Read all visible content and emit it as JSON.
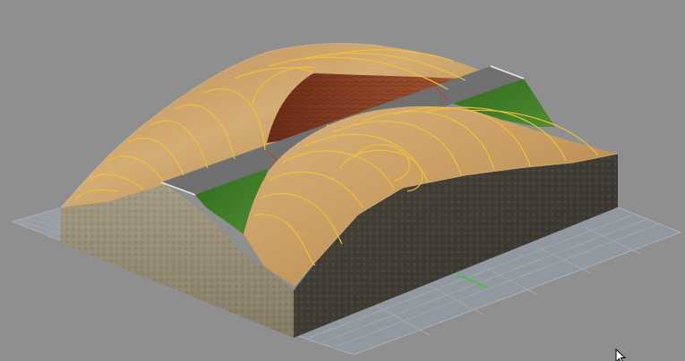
{
  "viewport": {
    "label": "",
    "background": "#8f8f8f"
  },
  "scene": {
    "object": "terrain-block-with-road-cut",
    "contour_color": "#f2c13a",
    "terrain_top_color": "#c9a064",
    "road_color": "#6e6e6e",
    "cut_slope_color": "#7e3a22",
    "grass_color": "#3f7a26",
    "soil_side_light": "#9b8f78",
    "soil_side_dark": "#3e3a32",
    "grid_color": "#9fa7b0",
    "axis_x_color": "#c83a3a",
    "axis_y_color": "#39c43a"
  },
  "cursor": {
    "icon": "arrow-cursor-icon"
  }
}
